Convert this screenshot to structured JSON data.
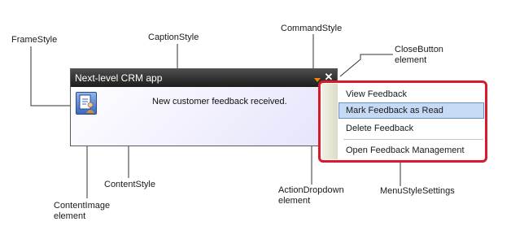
{
  "callouts": {
    "frame_style": "FrameStyle",
    "caption_style": "CaptionStyle",
    "command_style": "CommandStyle",
    "close_button": "CloseButton\nelement",
    "content_image": "ContentImage\nelement",
    "content_style": "ContentStyle",
    "action_dropdown": "ActionDropdown\nelement",
    "menu_style_settings": "MenuStyleSettings"
  },
  "alert": {
    "title": "Next-level CRM app",
    "content_text": "New customer feedback received.",
    "close_glyph": "✕"
  },
  "menu": {
    "items": [
      {
        "label": "View Feedback"
      },
      {
        "label": "Mark Feedback as Read",
        "selected": true
      },
      {
        "label": "Delete Feedback"
      },
      {
        "label": "Open Feedback Management"
      }
    ]
  },
  "colors": {
    "callout_line": "#333333",
    "menu_highlight_frame": "#d61c2c",
    "action_dropdown_arrow": "#f08a00",
    "selected_item_bg": "#c7daf5"
  },
  "icons": {
    "action_dropdown": "triangle-down-icon",
    "close": "close-icon",
    "content_image": "feedback-document-icon"
  }
}
